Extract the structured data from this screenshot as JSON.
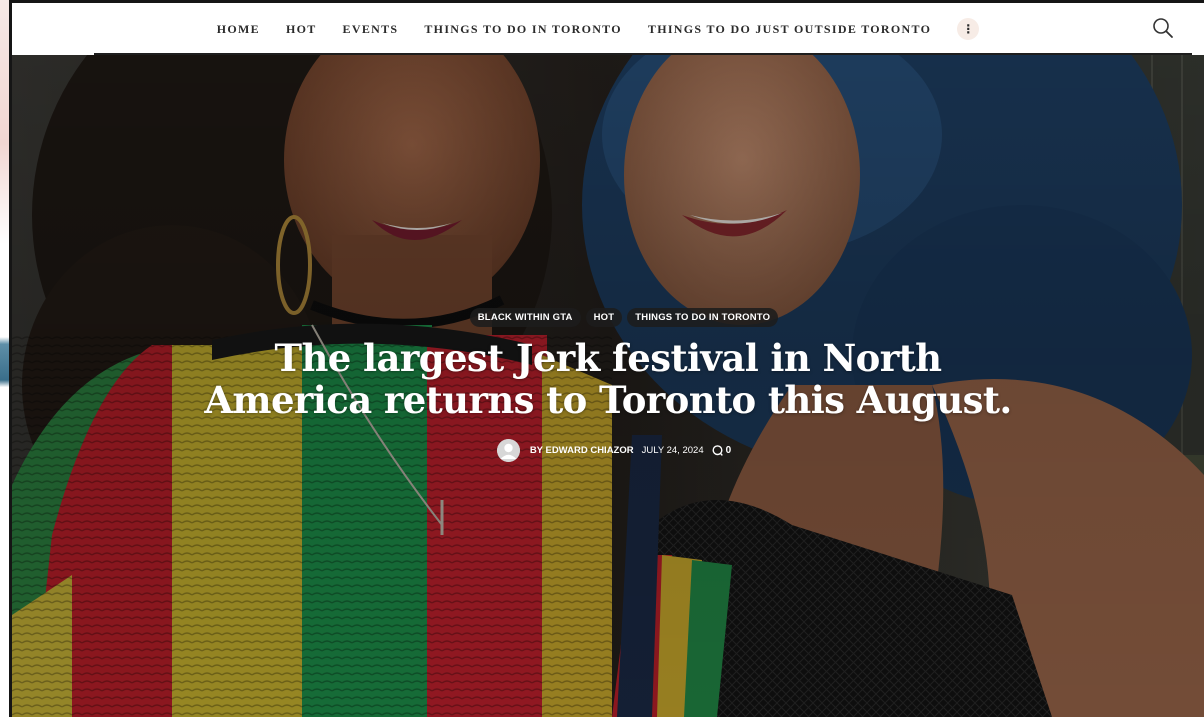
{
  "nav": {
    "items": [
      {
        "label": "HOME"
      },
      {
        "label": "HOT"
      },
      {
        "label": "EVENTS"
      },
      {
        "label": "THINGS TO DO IN TORONTO"
      },
      {
        "label": "THINGS TO DO JUST OUTSIDE TORONTO"
      }
    ],
    "more_glyph": "⋮",
    "search_icon": "search-icon"
  },
  "article": {
    "tags": [
      {
        "label": "BLACK WITHIN GTA"
      },
      {
        "label": "HOT"
      },
      {
        "label": "THINGS TO DO IN TORONTO"
      }
    ],
    "title": "The largest Jerk festival in North America returns to Toronto this August.",
    "author": "BY EDWARD CHIAZOR",
    "date": "JULY 24, 2024",
    "comments_count": "0",
    "comment_icon": "comment-icon"
  },
  "colors": {
    "accent_more_bg": "#f7ece6",
    "tag_bg": "#1c1c1c",
    "nav_text": "#2b2b2b"
  }
}
